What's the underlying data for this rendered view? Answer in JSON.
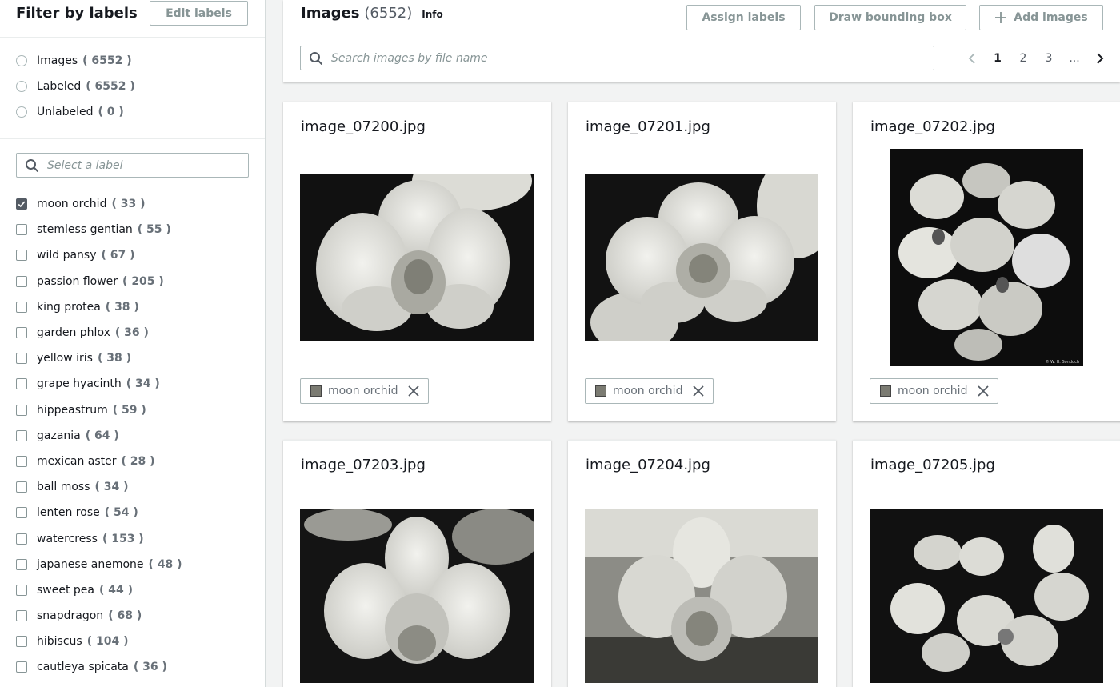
{
  "sidebar": {
    "title": "Filter by labels",
    "edit_label": "Edit labels",
    "filters": [
      {
        "label": "Images",
        "count": "( 6552 )"
      },
      {
        "label": "Labeled",
        "count": "( 6552 )"
      },
      {
        "label": "Unlabeled",
        "count": "( 0 )"
      }
    ],
    "search_placeholder": "Select a label",
    "labels": [
      {
        "label": "moon orchid",
        "count": "( 33 )",
        "checked": true
      },
      {
        "label": "stemless gentian",
        "count": "( 55 )"
      },
      {
        "label": "wild pansy",
        "count": "( 67 )"
      },
      {
        "label": "passion flower",
        "count": "( 205 )"
      },
      {
        "label": "king protea",
        "count": "( 38 )"
      },
      {
        "label": "garden phlox",
        "count": "( 36 )"
      },
      {
        "label": "yellow iris",
        "count": "( 38 )"
      },
      {
        "label": "grape hyacinth",
        "count": "( 34 )"
      },
      {
        "label": "hippeastrum",
        "count": "( 59 )"
      },
      {
        "label": "gazania",
        "count": "( 64 )"
      },
      {
        "label": "mexican aster",
        "count": "( 28 )"
      },
      {
        "label": "ball moss",
        "count": "( 34 )"
      },
      {
        "label": "lenten rose",
        "count": "( 54 )"
      },
      {
        "label": "watercress",
        "count": "( 153 )"
      },
      {
        "label": "japanese anemone",
        "count": "( 48 )"
      },
      {
        "label": "sweet pea",
        "count": "( 44 )"
      },
      {
        "label": "snapdragon",
        "count": "( 68 )"
      },
      {
        "label": "hibiscus",
        "count": "( 104 )"
      },
      {
        "label": "cautleya spicata",
        "count": "( 36 )"
      }
    ]
  },
  "header": {
    "title": "Images",
    "count": "(6552)",
    "info": "Info",
    "assign_label": "Assign labels",
    "draw_label": "Draw bounding box",
    "add_label": "Add images",
    "search_placeholder": "Search images by file name",
    "pages": [
      "1",
      "2",
      "3",
      "..."
    ],
    "current_page": "1"
  },
  "cards": [
    {
      "filename": "image_07200.jpg",
      "tag": "moon orchid"
    },
    {
      "filename": "image_07201.jpg",
      "tag": "moon orchid"
    },
    {
      "filename": "image_07202.jpg",
      "tag": "moon orchid",
      "watermark": "© W. H. Sondoch"
    },
    {
      "filename": "image_07203.jpg"
    },
    {
      "filename": "image_07204.jpg"
    },
    {
      "filename": "image_07205.jpg"
    }
  ],
  "icons": {
    "search": "search-icon",
    "plus": "plus-icon",
    "chevron_left": "chevron-left-icon",
    "chevron_right": "chevron-right-icon",
    "close": "close-icon",
    "check": "checkmark-icon"
  },
  "colors": {
    "border": "#aab7b8",
    "text": "#16191f",
    "muted": "#687078",
    "disabled_button_text": "#879596",
    "tag_swatch": "#7b7b72"
  }
}
